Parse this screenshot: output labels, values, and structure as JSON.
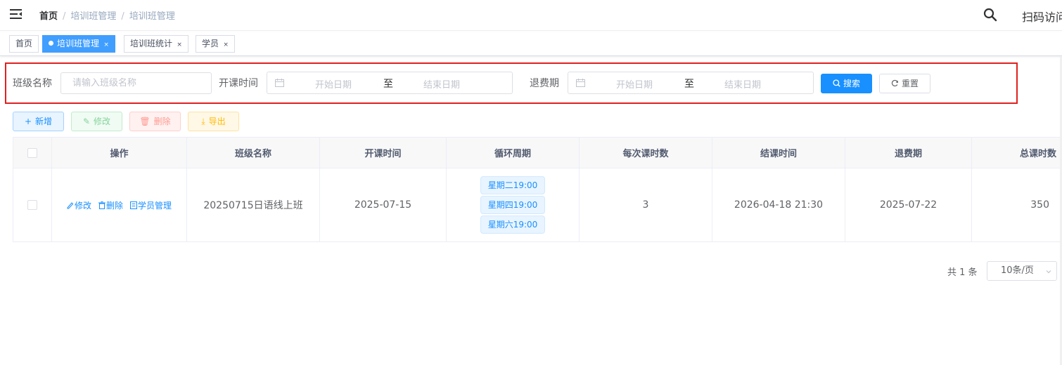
{
  "breadcrumb": {
    "home": "首页",
    "separator": "/",
    "level1": "培训班管理",
    "level2": "培训班管理"
  },
  "navbar": {
    "scan_label": "扫码访问"
  },
  "tags": [
    {
      "label": "首页",
      "active": false
    },
    {
      "label": "培训班管理",
      "active": true,
      "close": "×"
    },
    {
      "label": "培训班统计",
      "active": false,
      "close": "×"
    },
    {
      "label": "学员",
      "active": false,
      "close": "×"
    }
  ],
  "filters": {
    "class_name_label": "班级名称",
    "class_name_placeholder": "请输入班级名称",
    "start_time_label": "开课时间",
    "start_time_from": "开始日期",
    "start_time_sep": "至",
    "start_time_to": "结束日期",
    "refund_label": "退费期",
    "refund_from": "开始日期",
    "refund_sep": "至",
    "refund_to": "结束日期",
    "search_label": "搜索",
    "reset_label": "重置"
  },
  "toolbar": {
    "add_label": "新增",
    "edit_label": "修改",
    "delete_label": "删除",
    "export_label": "导出"
  },
  "table": {
    "headers": [
      "操作",
      "班级名称",
      "开课时间",
      "循环周期",
      "每次课时数",
      "结课时间",
      "退费期",
      "总课时数"
    ],
    "rows": [
      {
        "actions": {
          "edit": "修改",
          "delete": "删除",
          "students": "学员管理"
        },
        "class_name": "20250715日语线上班",
        "start_date": "2025-07-15",
        "cycle": [
          "星期二19:00",
          "星期四19:00",
          "星期六19:00"
        ],
        "hours_per_class": "3",
        "end_time": "2026-04-18 21:30",
        "refund_date": "2025-07-22",
        "total_hours": "350"
      }
    ]
  },
  "pagination": {
    "total_text": "共 1 条",
    "page_size": "10条/页"
  },
  "colors": {
    "primary": "#1890ff",
    "highlight_border": "#e02020"
  }
}
